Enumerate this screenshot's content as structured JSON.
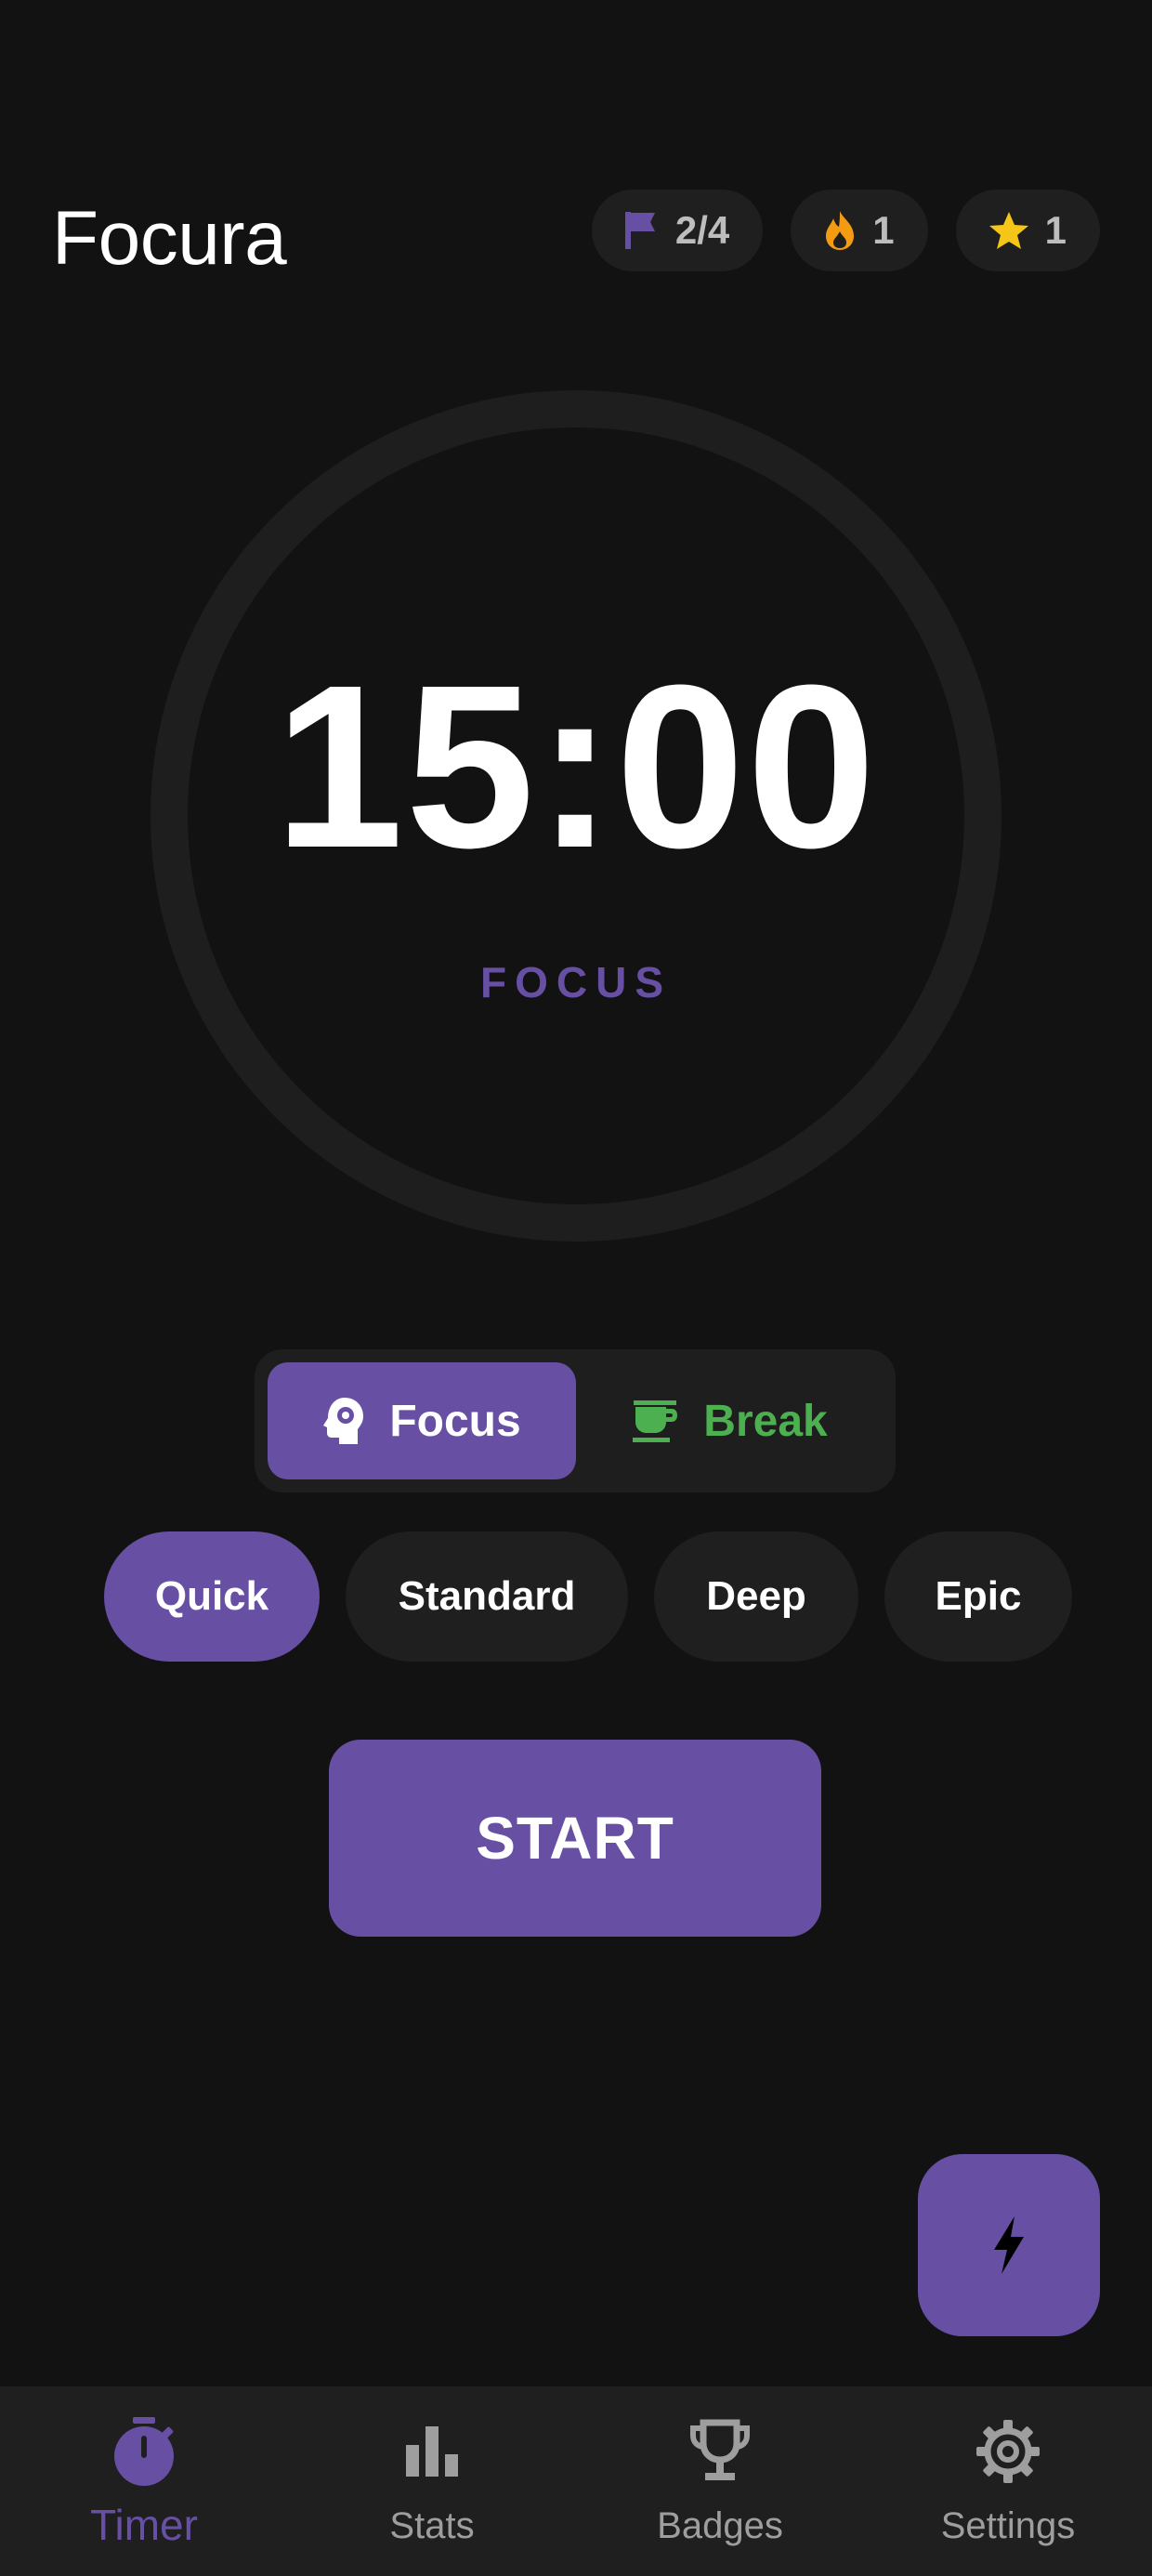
{
  "app": {
    "title": "Focura"
  },
  "header": {
    "badges": [
      {
        "icon": "flag-icon",
        "value": "2/4",
        "color": "#6750a4"
      },
      {
        "icon": "flame-icon",
        "value": "1",
        "color": "#f39c12"
      },
      {
        "icon": "star-icon",
        "value": "1",
        "color": "#f5c518"
      }
    ]
  },
  "timer": {
    "time": "15:00",
    "mode_label": "FOCUS",
    "progress": 0
  },
  "mode_toggle": {
    "focus_label": "Focus",
    "break_label": "Break",
    "selected": "Focus"
  },
  "presets": {
    "items": [
      "Quick",
      "Standard",
      "Deep",
      "Epic"
    ],
    "selected": "Quick"
  },
  "actions": {
    "start_label": "START"
  },
  "fab": {
    "icon": "lightning-icon"
  },
  "bottom_nav": {
    "items": [
      {
        "label": "Timer",
        "icon": "stopwatch-icon",
        "active": true
      },
      {
        "label": "Stats",
        "icon": "bar-chart-icon",
        "active": false
      },
      {
        "label": "Badges",
        "icon": "trophy-icon",
        "active": false
      },
      {
        "label": "Settings",
        "icon": "gear-icon",
        "active": false
      }
    ]
  },
  "colors": {
    "background": "#121212",
    "surface": "#1f1f1f",
    "accent": "#6750a4",
    "break_green": "#4caf50",
    "muted_text": "#9e9e9e"
  }
}
